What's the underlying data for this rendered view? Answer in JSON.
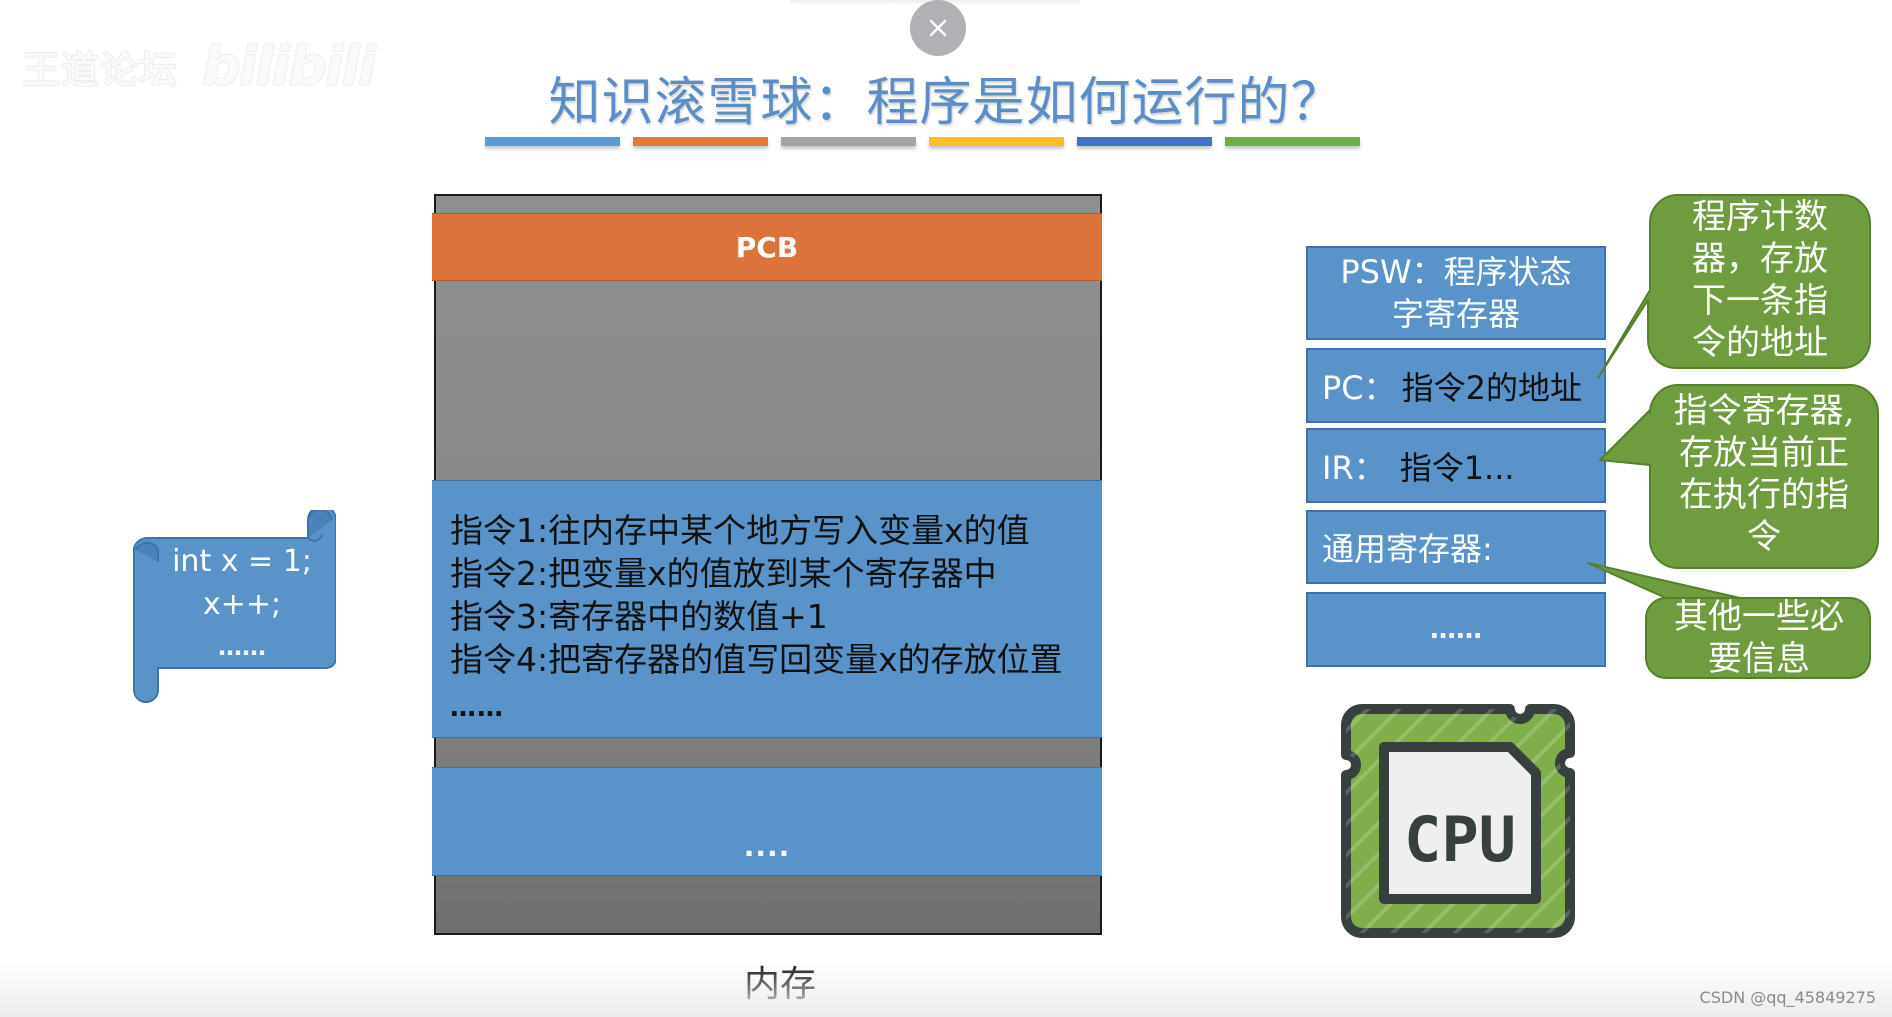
{
  "watermark": {
    "text": "王道论坛",
    "brand": "bilibili"
  },
  "close_button": {
    "icon": "close-icon",
    "symbol": "×"
  },
  "title": "知识滚雪球：程序是如何运行的？",
  "title_bars": {
    "colors": [
      "#5b9bd5",
      "#e07a3a",
      "#a5a5a5",
      "#fbbd2e",
      "#4472c4",
      "#70ad47"
    ]
  },
  "code_scroll": {
    "lines": [
      "int x = 1;",
      "x++;",
      "……"
    ]
  },
  "memory": {
    "label": "内存",
    "pcb_label": "PCB",
    "instructions": [
      "指令1:往内存中某个地方写入变量x的值",
      "指令2:把变量x的值放到某个寄存器中",
      "指令3:寄存器中的数值+1",
      "指令4:把寄存器的值写回变量x的存放位置"
    ],
    "instructions_more": "……",
    "other_block": "...."
  },
  "registers": {
    "psw_line1": "PSW：程序状态",
    "psw_line2": "字寄存器",
    "pc_label": "PC：",
    "pc_value": "指令2的地址",
    "ir_label": "IR：",
    "ir_value": "指令1...",
    "general_label": "通用寄存器:",
    "more": "……"
  },
  "callouts": {
    "pc": [
      "程序计数",
      "器，存放",
      "下一条指",
      "令的地址"
    ],
    "ir": [
      "指令寄存器,",
      "存放当前正",
      "在执行的指",
      "令"
    ],
    "other": [
      "其他一些必",
      "要信息"
    ]
  },
  "cpu_icon": {
    "label": "CPU"
  },
  "credit": "CSDN @qq_45849275",
  "colors": {
    "title": "#5b8ec7",
    "pcb": "#dc733c",
    "block_blue": "#5a93c9",
    "callout_green": "#6f9c3f",
    "memory_gray": "#8a8a8a"
  }
}
